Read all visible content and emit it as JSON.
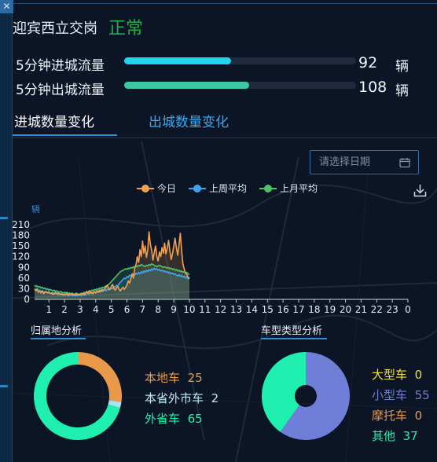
{
  "window": {
    "corner_icon": "x-icon"
  },
  "header": {
    "station_name": "迎宾西立交岗",
    "status": "正常",
    "status_color": "#1fae4a"
  },
  "flows": [
    {
      "label": "5分钟进城流量",
      "value": "92",
      "unit": "辆",
      "percent": 46,
      "color": "#22d3ee"
    },
    {
      "label": "5分钟出城流量",
      "value": "108",
      "unit": "辆",
      "percent": 54,
      "color": "#3cc9a3"
    }
  ],
  "tabs": [
    {
      "label": "进城数量变化",
      "active": true
    },
    {
      "label": "出城数量变化",
      "active": false
    }
  ],
  "date_picker": {
    "placeholder": "请选择日期",
    "icon": "calendar-icon"
  },
  "toolbar": {
    "download_icon": "download-icon"
  },
  "chart_data": {
    "type": "line",
    "ylabel": "辆",
    "yticks": [
      0,
      30,
      60,
      90,
      120,
      150,
      180,
      210
    ],
    "ylim": [
      0,
      210
    ],
    "xticks": [
      "1",
      "2",
      "3",
      "4",
      "5",
      "6",
      "7",
      "8",
      "9",
      "10",
      "11",
      "12",
      "13",
      "14",
      "15",
      "16",
      "17",
      "18",
      "19",
      "20",
      "21",
      "22",
      "23",
      "0"
    ],
    "points_per_hour": 12,
    "legend_position": "top",
    "grid": false,
    "series": [
      {
        "name": "今日",
        "color": "#f2a04e",
        "values": [
          30,
          24,
          28,
          20,
          22,
          18,
          24,
          16,
          20,
          22,
          18,
          20,
          16,
          18,
          14,
          16,
          20,
          15,
          18,
          16,
          14,
          16,
          12,
          15,
          14,
          16,
          12,
          14,
          13,
          15,
          12,
          14,
          13,
          15,
          12,
          14,
          14,
          16,
          13,
          18,
          22,
          16,
          24,
          18,
          20,
          16,
          22,
          18,
          24,
          20,
          26,
          22,
          28,
          24,
          30,
          34,
          40,
          32,
          28,
          36,
          42,
          30,
          26,
          32,
          36,
          28,
          24,
          30,
          34,
          28,
          34,
          40,
          52,
          46,
          58,
          72,
          60,
          88,
          98,
          120,
          104,
          140,
          120,
          164,
          130,
          150,
          118,
          140,
          190,
          155,
          138,
          110,
          132,
          150,
          120,
          108,
          134,
          120,
          146,
          130,
          158,
          128,
          144,
          166,
          136,
          112,
          128,
          150,
          172,
          146,
          124,
          152,
          186,
          140,
          100,
          86,
          74,
          70,
          62,
          58
        ]
      },
      {
        "name": "上周平均",
        "color": "#3ea6ee",
        "values": [
          28,
          26,
          30,
          24,
          26,
          22,
          24,
          20,
          22,
          20,
          18,
          22,
          16,
          18,
          20,
          14,
          16,
          18,
          12,
          14,
          16,
          12,
          14,
          12,
          12,
          14,
          10,
          12,
          14,
          10,
          12,
          10,
          12,
          10,
          12,
          14,
          10,
          14,
          16,
          12,
          16,
          18,
          14,
          20,
          16,
          18,
          22,
          18,
          20,
          24,
          20,
          26,
          22,
          24,
          28,
          24,
          30,
          26,
          28,
          32,
          30,
          36,
          34,
          40,
          38,
          44,
          48,
          52,
          56,
          60,
          58,
          64,
          62,
          68,
          66,
          70,
          72,
          68,
          74,
          70,
          76,
          72,
          78,
          74,
          80,
          76,
          82,
          78,
          84,
          80,
          86,
          82,
          88,
          84,
          86,
          82,
          84,
          80,
          82,
          78,
          80,
          76,
          78,
          74,
          76,
          72,
          74,
          70,
          72,
          68,
          66,
          70,
          64,
          68,
          62,
          66,
          60,
          64,
          58,
          62
        ]
      },
      {
        "name": "上月平均",
        "color": "#4fc26a",
        "values": [
          40,
          36,
          38,
          34,
          36,
          32,
          34,
          30,
          32,
          28,
          30,
          26,
          28,
          26,
          24,
          26,
          22,
          24,
          22,
          20,
          22,
          20,
          18,
          20,
          18,
          20,
          16,
          18,
          16,
          18,
          14,
          16,
          18,
          16,
          14,
          16,
          18,
          16,
          20,
          18,
          22,
          20,
          24,
          22,
          26,
          24,
          28,
          26,
          30,
          28,
          32,
          30,
          34,
          32,
          36,
          38,
          40,
          42,
          46,
          50,
          54,
          58,
          62,
          66,
          70,
          74,
          78,
          80,
          82,
          84,
          86,
          84,
          88,
          86,
          90,
          88,
          92,
          90,
          94,
          92,
          96,
          94,
          98,
          96,
          94,
          92,
          96,
          94,
          98,
          96,
          100,
          98,
          96,
          94,
          92,
          94,
          96,
          94,
          92,
          90,
          92,
          90,
          88,
          90,
          86,
          88,
          84,
          86,
          82,
          84,
          80,
          82,
          78,
          80,
          76,
          78,
          74,
          76,
          72,
          70
        ]
      }
    ]
  },
  "origin_section": {
    "title": "归属地分析",
    "chart_data": {
      "type": "pie",
      "labels": [
        "本地车",
        "本省外市车",
        "外省车"
      ],
      "values": [
        25,
        2,
        65
      ],
      "colors": [
        "#e8994a",
        "#a8e3f3",
        "#1ff0b0"
      ]
    }
  },
  "vehicle_section": {
    "title": "车型类型分析",
    "chart_data": {
      "type": "pie",
      "labels": [
        "大型车",
        "小型车",
        "摩托车",
        "其他"
      ],
      "values": [
        0,
        55,
        0,
        37
      ],
      "colors": [
        "#f0e23c",
        "#6f7fd8",
        "#e8994a",
        "#1ff0b0"
      ]
    }
  }
}
